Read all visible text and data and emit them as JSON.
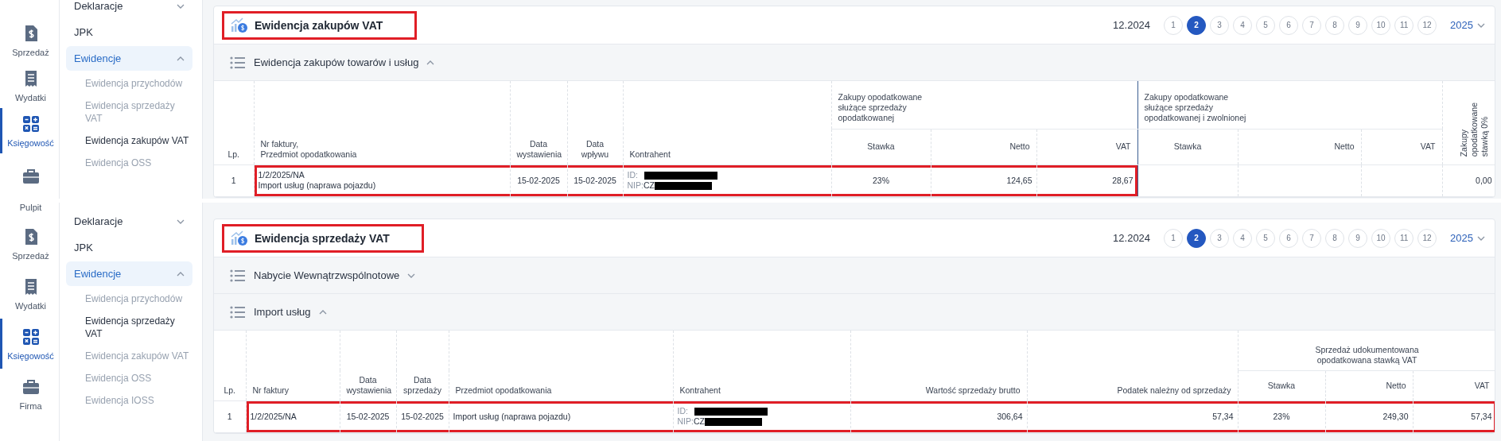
{
  "panels": [
    {
      "rail": [
        {
          "kind": "sales",
          "label": "Sprzedaż",
          "selected": false
        },
        {
          "kind": "expenses",
          "label": "Wydatki",
          "selected": false
        },
        {
          "kind": "accounting",
          "label": "Księgowość",
          "selected": true
        },
        {
          "kind": "company",
          "selected": false
        }
      ],
      "submenu": [
        {
          "label": "Deklaracje",
          "expanded": false
        },
        {
          "label": "JPK"
        },
        {
          "label": "Ewidencje",
          "expanded": true,
          "children": [
            {
              "label": "Ewidencja przychodów",
              "selected": false
            },
            {
              "label": "Ewidencja sprzedaży VAT",
              "selected": false
            },
            {
              "label": "Ewidencja zakupów VAT",
              "selected": true
            },
            {
              "label": "Ewidencja OSS",
              "selected": false
            }
          ]
        }
      ],
      "card": {
        "title": "Ewidencja zakupów VAT",
        "title_highlighted": true,
        "period": "12.2024",
        "months": [
          {
            "label": "1",
            "selected": false
          },
          {
            "label": "2",
            "selected": true
          },
          {
            "label": "3",
            "selected": false
          },
          {
            "label": "4",
            "selected": false
          },
          {
            "label": "5",
            "selected": false
          },
          {
            "label": "6",
            "selected": false
          },
          {
            "label": "7",
            "selected": false
          },
          {
            "label": "8",
            "selected": false
          },
          {
            "label": "9",
            "selected": false
          },
          {
            "label": "10",
            "selected": false
          },
          {
            "label": "11",
            "selected": false
          },
          {
            "label": "12",
            "selected": false
          }
        ],
        "year": "2025",
        "sections": [
          {
            "title": "Ewidencja zakupów towarów i usług",
            "expanded": true
          }
        ],
        "table": {
          "header_rows": [
            [
              {
                "kind": "index",
                "label": "Lp.",
                "rowspan": 2
              },
              {
                "kind": "text",
                "label": "Nr faktury,\nPrzedmiot opodatkowania",
                "rowspan": 2
              },
              {
                "kind": "date",
                "label": "Data\nwystawienia",
                "rowspan": 2
              },
              {
                "kind": "date",
                "label": "Data\nwpływu",
                "rowspan": 2
              },
              {
                "kind": "text",
                "label": "Kontrahent",
                "rowspan": 2
              },
              {
                "kind": "group",
                "label": "Zakupy opodatkowane\nsłużące sprzedaży\nopodatkowanej",
                "colspan": 3
              },
              {
                "kind": "group",
                "label": "Zakupy opodatkowane\nsłużące sprzedaży\nopodatkowanej i zwolnionej",
                "colspan": 3
              },
              {
                "kind": "vertical",
                "label": "Zakupy\nopodatkowane\nstawką 0%",
                "rowspan": 2
              }
            ],
            [
              {
                "kind": "rate",
                "label": "Stawka"
              },
              {
                "kind": "amount",
                "label": "Netto"
              },
              {
                "kind": "amount",
                "label": "VAT"
              },
              {
                "kind": "rate",
                "label": "Stawka"
              },
              {
                "kind": "amount",
                "label": "Netto"
              },
              {
                "kind": "amount",
                "label": "VAT"
              }
            ]
          ],
          "rows": [
            {
              "cells": [
                {
                  "kind": "text",
                  "text": "1",
                  "highlighted": false
                },
                {
                  "kind": "lines",
                  "lines": [
                    "1/2/2025/NA",
                    "Import usług (naprawa pojazdu)"
                  ],
                  "highlighted": true
                },
                {
                  "kind": "text",
                  "text": "15-02-2025",
                  "highlighted": true
                },
                {
                  "kind": "text",
                  "text": "15-02-2025",
                  "highlighted": true
                },
                {
                  "kind": "contractor",
                  "id_label": "ID:",
                  "nip_label": "NIP:",
                  "nip_prefix": "CZ",
                  "highlighted": true
                },
                {
                  "kind": "text",
                  "text": "23%",
                  "highlighted": true
                },
                {
                  "kind": "text",
                  "text": "124,65",
                  "highlighted": true
                },
                {
                  "kind": "text",
                  "text": "28,67",
                  "highlighted": true
                },
                {
                  "kind": "blank",
                  "highlighted": false
                },
                {
                  "kind": "blank",
                  "highlighted": false
                },
                {
                  "kind": "blank",
                  "highlighted": false
                },
                {
                  "kind": "text",
                  "text": "0,00",
                  "highlighted": false
                }
              ]
            }
          ]
        }
      }
    },
    {
      "rail": [
        {
          "kind": "home",
          "label": "Pulpit",
          "selected": false
        },
        {
          "kind": "sales",
          "label": "Sprzedaż",
          "selected": false
        },
        {
          "kind": "expenses",
          "label": "Wydatki",
          "selected": false
        },
        {
          "kind": "accounting",
          "label": "Księgowość",
          "selected": true
        },
        {
          "kind": "company",
          "label": "Firma",
          "selected": false
        }
      ],
      "submenu": [
        {
          "label": "Deklaracje",
          "expanded": false
        },
        {
          "label": "JPK"
        },
        {
          "label": "Ewidencje",
          "expanded": true,
          "children": [
            {
              "label": "Ewidencja przychodów",
              "selected": false
            },
            {
              "label": "Ewidencja sprzedaży VAT",
              "selected": true
            },
            {
              "label": "Ewidencja zakupów VAT",
              "selected": false
            },
            {
              "label": "Ewidencja OSS",
              "selected": false
            },
            {
              "label": "Ewidencja IOSS",
              "selected": false
            }
          ]
        }
      ],
      "card": {
        "title": "Ewidencja sprzedaży VAT",
        "title_highlighted": true,
        "period": "12.2024",
        "months": [
          {
            "label": "1",
            "selected": false
          },
          {
            "label": "2",
            "selected": true
          },
          {
            "label": "3",
            "selected": false
          },
          {
            "label": "4",
            "selected": false
          },
          {
            "label": "5",
            "selected": false
          },
          {
            "label": "6",
            "selected": false
          },
          {
            "label": "7",
            "selected": false
          },
          {
            "label": "8",
            "selected": false
          },
          {
            "label": "9",
            "selected": false
          },
          {
            "label": "10",
            "selected": false
          },
          {
            "label": "11",
            "selected": false
          },
          {
            "label": "12",
            "selected": false
          }
        ],
        "year": "2025",
        "sections": [
          {
            "title": "Nabycie Wewnątrzwspólnotowe",
            "expanded": false
          },
          {
            "title": "Import usług",
            "expanded": true
          }
        ],
        "table": {
          "header_rows": [
            [
              {
                "kind": "index",
                "label": "Lp.",
                "rowspan": 2
              },
              {
                "kind": "text",
                "label": "Nr faktury",
                "rowspan": 2
              },
              {
                "kind": "date",
                "label": "Data\nwystawienia",
                "rowspan": 2
              },
              {
                "kind": "date",
                "label": "Data\nsprzedaży",
                "rowspan": 2
              },
              {
                "kind": "text",
                "label": "Przedmiot opodatkowania",
                "rowspan": 2
              },
              {
                "kind": "text",
                "label": "Kontrahent",
                "rowspan": 2
              },
              {
                "kind": "amount",
                "label": "Wartość sprzedaży brutto",
                "rowspan": 2
              },
              {
                "kind": "amount",
                "label": "Podatek należny od sprzedaży",
                "rowspan": 2
              },
              {
                "kind": "group",
                "label": "Sprzedaż udokumentowana\nopodatkowana stawką VAT",
                "colspan": 3
              }
            ],
            [
              {
                "kind": "rate",
                "label": "Stawka"
              },
              {
                "kind": "amount",
                "label": "Netto"
              },
              {
                "kind": "amount",
                "label": "VAT"
              }
            ]
          ],
          "rows": [
            {
              "cells": [
                {
                  "kind": "text",
                  "text": "1",
                  "highlighted": false
                },
                {
                  "kind": "text",
                  "text": "1/2/2025/NA",
                  "highlighted": true
                },
                {
                  "kind": "text",
                  "text": "15-02-2025",
                  "highlighted": true
                },
                {
                  "kind": "text",
                  "text": "15-02-2025",
                  "highlighted": true
                },
                {
                  "kind": "text",
                  "text": "Import usług (naprawa pojazdu)",
                  "highlighted": true
                },
                {
                  "kind": "contractor",
                  "id_label": "ID:",
                  "nip_label": "NIP:",
                  "nip_prefix": "CZ",
                  "highlighted": true
                },
                {
                  "kind": "text",
                  "text": "306,64",
                  "highlighted": true
                },
                {
                  "kind": "text",
                  "text": "57,34",
                  "highlighted": true
                },
                {
                  "kind": "text",
                  "text": "23%",
                  "highlighted": true
                },
                {
                  "kind": "text",
                  "text": "249,30",
                  "highlighted": true
                },
                {
                  "kind": "text",
                  "text": "57,34",
                  "highlighted": true
                }
              ]
            }
          ]
        }
      }
    }
  ]
}
